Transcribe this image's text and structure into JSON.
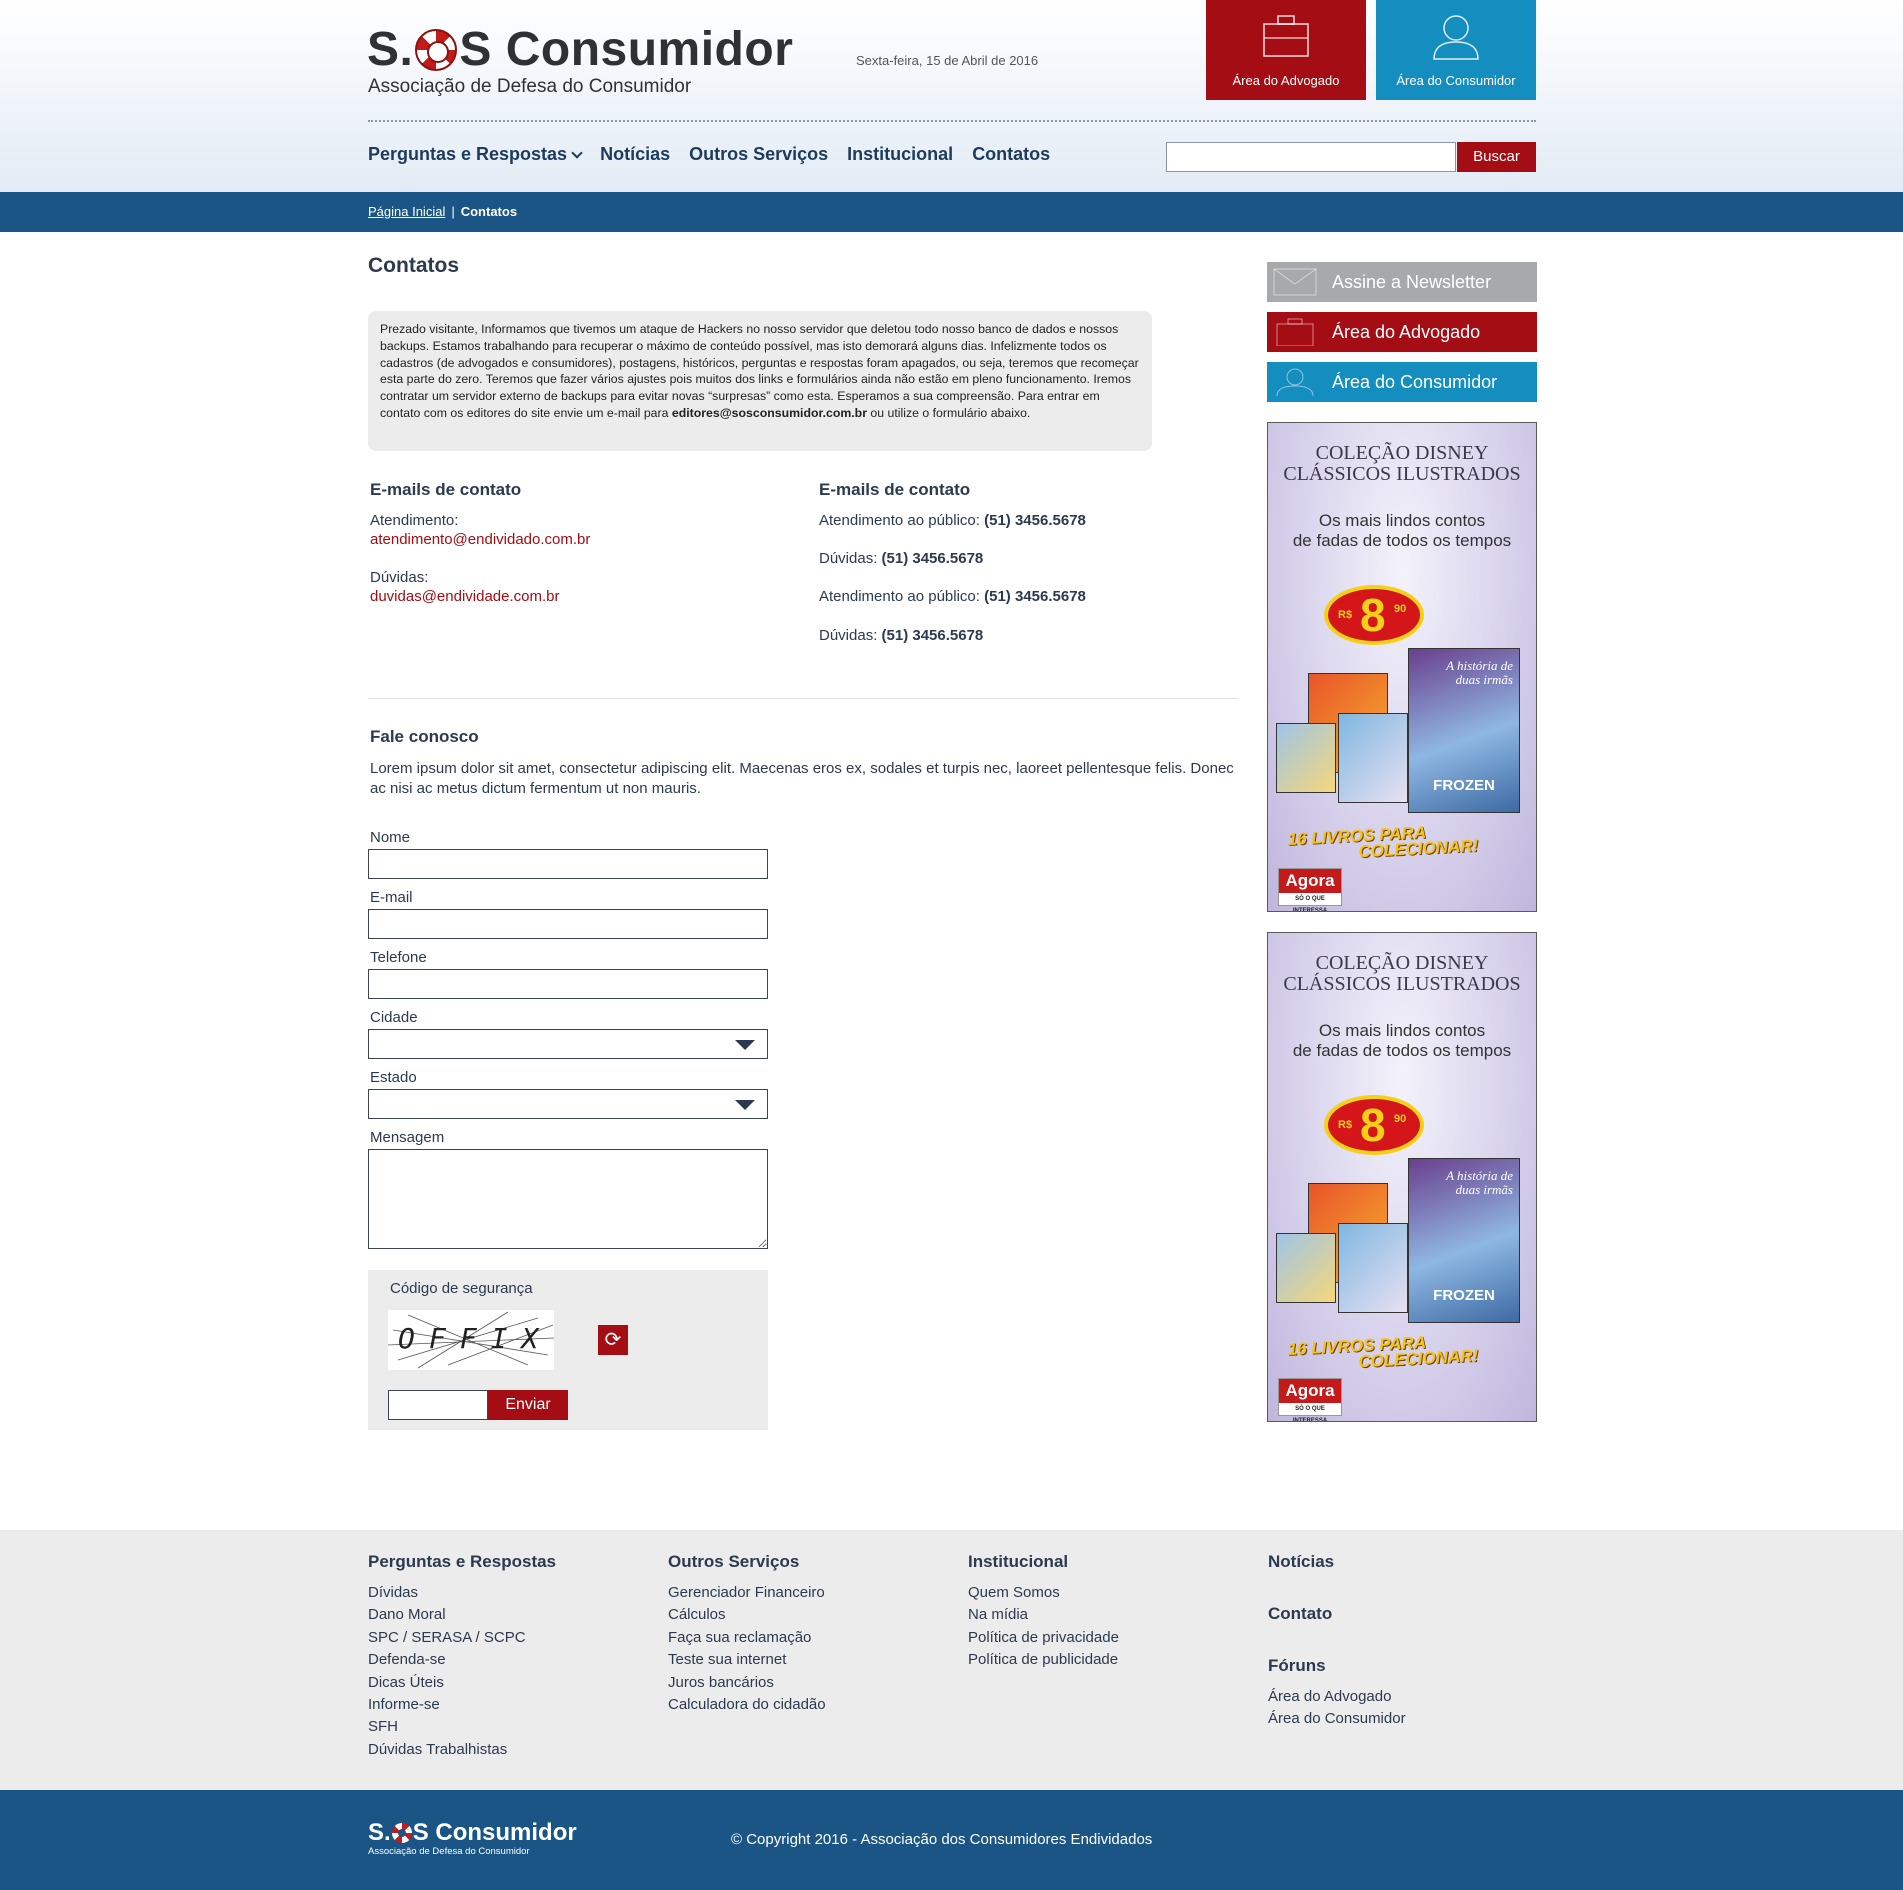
{
  "header": {
    "logo_main_a": "S.",
    "logo_main_b": "S Consumidor",
    "logo_sub": "Associação de Defesa do Consumidor",
    "date": "Sexta-feira, 15 de Abril de 2016",
    "area_advogado": "Área do Advogado",
    "area_consumidor": "Área do Consumidor",
    "search_button": "Buscar",
    "search_placeholder": "",
    "nav": [
      "Perguntas e Respostas",
      "Notícias",
      "Outros Serviços",
      "Institucional",
      "Contatos"
    ]
  },
  "breadcrumb": {
    "home": "Página Inicial",
    "separator": "|",
    "current": "Contatos"
  },
  "main": {
    "title": "Contatos",
    "notice_text": "Prezado visitante, Informamos que tivemos um ataque de Hackers no nosso servidor que deletou todo nosso banco de dados e nossos backups. Estamos trabalhando para recuperar o máximo de conteúdo possível, mas isto demorará alguns dias. Infelizmente todos os cadastros (de advogados e consumidores), postagens, históricos, perguntas e respostas foram apagados, ou seja, teremos que recomeçar esta parte do zero. Teremos que fazer vários ajustes pois muitos dos links e formulários ainda não estão em pleno funcionamento. Iremos contratar um servidor externo de backups para evitar novas “surpresas” como esta. Esperamos a sua compreensão. Para entrar em contato com os editores do site envie um e-mail para ",
    "notice_email": "editores@sosconsumidor.com.br",
    "notice_tail": " ou utilize o formulário abaixo.",
    "emails": {
      "title": "E-mails de contato",
      "atendimento_label": "Atendimento:",
      "atendimento_email": "atendimento@endividado.com.br",
      "duvidas_label": "Dúvidas:",
      "duvidas_email": "duvidas@endividade.com.br"
    },
    "phones": {
      "title": "E-mails de contato",
      "items": [
        {
          "label": "Atendimento ao público:",
          "value": "(51) 3456.5678"
        },
        {
          "label": "Dúvidas:",
          "value": "(51) 3456.5678"
        },
        {
          "label": "Atendimento ao público:",
          "value": "(51) 3456.5678"
        },
        {
          "label": "Dúvidas:",
          "value": "(51) 3456.5678"
        }
      ]
    },
    "form": {
      "title": "Fale conosco",
      "intro": "Lorem ipsum dolor sit amet, consectetur adipiscing elit. Maecenas eros ex, sodales et turpis nec, laoreet pellentesque felis. Donec ac nisi ac metus dictum fermentum ut non mauris.",
      "nome": "Nome",
      "email": "E-mail",
      "telefone": "Telefone",
      "cidade": "Cidade",
      "estado": "Estado",
      "mensagem": "Mensagem",
      "captcha_title": "Código de segurança",
      "captcha_text": "OFFIX",
      "submit": "Enviar"
    }
  },
  "sidebar": {
    "newsletter": "Assine a Newsletter",
    "advogado": "Área do Advogado",
    "consumidor": "Área do Consumidor",
    "ad": {
      "title_1": "COLEÇÃO DISNEY",
      "title_2": "CLÁSSICOS ILUSTRADOS",
      "sub_1": "Os mais lindos contos",
      "sub_2": "de fadas de todos os tempos",
      "price_currency": "R$",
      "price_int": "8",
      "price_cents": "90",
      "book_title_1": "A história de",
      "book_title_2": "duas irmãs",
      "book_name": "FROZEN",
      "cta_1": "16 LIVROS PARA",
      "cta_2": "COLECIONAR!",
      "brand": "Agora",
      "brand_tag": "SÓ O QUE INTERESSA"
    }
  },
  "footer": {
    "col1": {
      "title": "Perguntas e Respostas",
      "links": [
        "Dívidas",
        "Dano Moral",
        "SPC / SERASA / SCPC",
        "Defenda-se",
        "Dicas Úteis",
        "Informe-se",
        "SFH",
        "Dúvidas Trabalhistas"
      ]
    },
    "col2": {
      "title": "Outros Serviços",
      "links": [
        "Gerenciador Financeiro",
        "Cálculos",
        "Faça sua reclamação",
        "Teste sua internet",
        "Juros bancários",
        "Calculadora do cidadão"
      ]
    },
    "col3": {
      "title": "Institucional",
      "links": [
        "Quem Somos",
        "Na mídia",
        "Política de privacidade",
        "Política de publicidade"
      ]
    },
    "col4": {
      "noticias": "Notícias",
      "contato": "Contato",
      "foruns": "Fóruns",
      "links": [
        "Área do Advogado",
        "Área do Consumidor"
      ]
    },
    "copyright": "© Copyright 2016 - Associação dos Consumidores Endividados"
  }
}
